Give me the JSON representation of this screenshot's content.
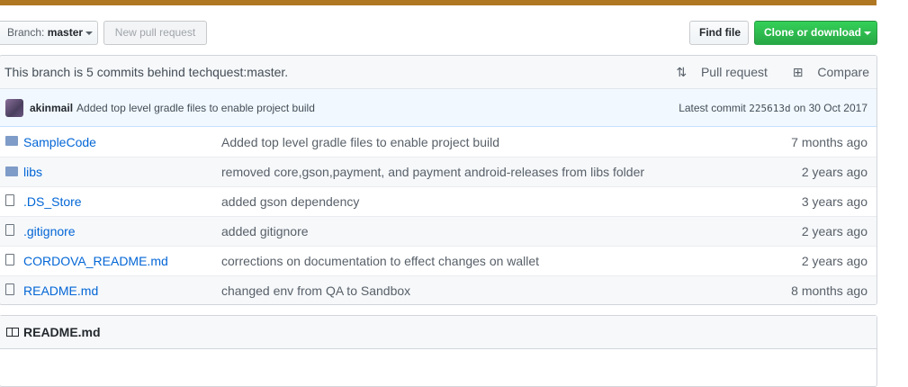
{
  "toolbar": {
    "branch_label": "Branch:",
    "branch_value": "master",
    "new_pr": "New pull request",
    "find_file": "Find file",
    "clone": "Clone or download"
  },
  "branch_info": {
    "text": "This branch is 5 commits behind techquest:master.",
    "pull_request": "Pull request",
    "compare": "Compare"
  },
  "latest_commit": {
    "author": "akinmail",
    "message": "Added top level gradle files to enable project build",
    "prefix": "Latest commit",
    "sha": "225613d",
    "date": "on 30 Oct 2017"
  },
  "files": [
    {
      "type": "folder",
      "name": "SampleCode",
      "message": "Added top level gradle files to enable project build",
      "age": "7 months ago"
    },
    {
      "type": "folder",
      "name": "libs",
      "message": "removed core,gson,payment, and payment android-releases from libs folder",
      "age": "2 years ago"
    },
    {
      "type": "file",
      "name": ".DS_Store",
      "message": "added gson dependency",
      "age": "3 years ago"
    },
    {
      "type": "file",
      "name": ".gitignore",
      "message": "added gitignore",
      "age": "2 years ago"
    },
    {
      "type": "file",
      "name": "CORDOVA_README.md",
      "message": "corrections on documentation to effect changes on wallet",
      "age": "2 years ago"
    },
    {
      "type": "file",
      "name": "README.md",
      "message": "changed env from QA to Sandbox",
      "age": "8 months ago"
    }
  ],
  "readme": {
    "title": "README.md"
  }
}
